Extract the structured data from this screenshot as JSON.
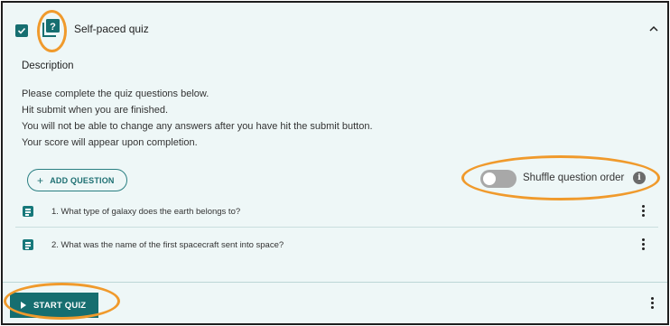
{
  "quiz": {
    "title": "Self-paced quiz",
    "selected": true,
    "icon": "question-mark-square-icon",
    "icon_glyph": "?"
  },
  "description": {
    "heading": "Description",
    "lines": [
      "Please complete the quiz questions below.",
      "Hit submit when you are finished.",
      "You will not be able to change any answers after you have hit the submit button.",
      "Your score will appear upon completion."
    ]
  },
  "actions": {
    "add_question_label": "ADD QUESTION",
    "shuffle_label": "Shuffle question order",
    "shuffle_enabled": false,
    "info_glyph": "i"
  },
  "questions": [
    {
      "text": "1. What type of galaxy does the earth belongs to?"
    },
    {
      "text": "2. What was the name of the first spacecraft sent into space?"
    }
  ],
  "footer": {
    "start_label": "START QUIZ"
  },
  "colors": {
    "accent": "#166e70",
    "highlight": "#f09a2c",
    "background": "#eef7f7"
  }
}
